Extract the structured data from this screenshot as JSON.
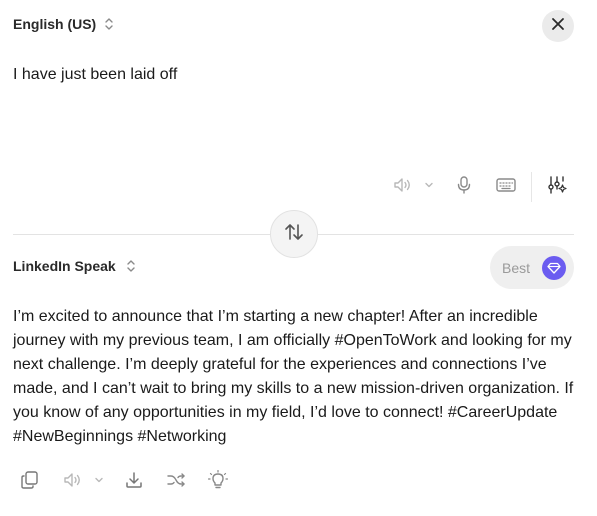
{
  "source": {
    "language_label": "English (US)",
    "input_text": "I have just been laid off"
  },
  "target": {
    "style_label": "LinkedIn Speak",
    "quality_label": "Best",
    "output_text": "I’m excited to announce that I’m starting a new chapter! After an incredible journey with my previous team, I am officially #OpenToWork and looking for my next challenge. I’m deeply grateful for the experiences and connections I’ve made, and I can’t wait to bring my skills to a new mission-driven organization. If you know of any opportunities in my field, I’d love to connect! #CareerUpdate #NewBeginnings #Networking"
  },
  "icons": {
    "close": "close-icon",
    "swap": "swap-arrows-icon",
    "speaker": "speaker-icon",
    "mic": "microphone-icon",
    "keyboard": "keyboard-icon",
    "settings": "sliders-sparkle-icon",
    "copy": "copy-icon",
    "download": "download-icon",
    "shuffle": "shuffle-icon",
    "bulb": "lightbulb-icon",
    "diamond": "diamond-icon"
  },
  "colors": {
    "accent": "#6b5cf0",
    "icon_gray": "#8a8a8a"
  }
}
